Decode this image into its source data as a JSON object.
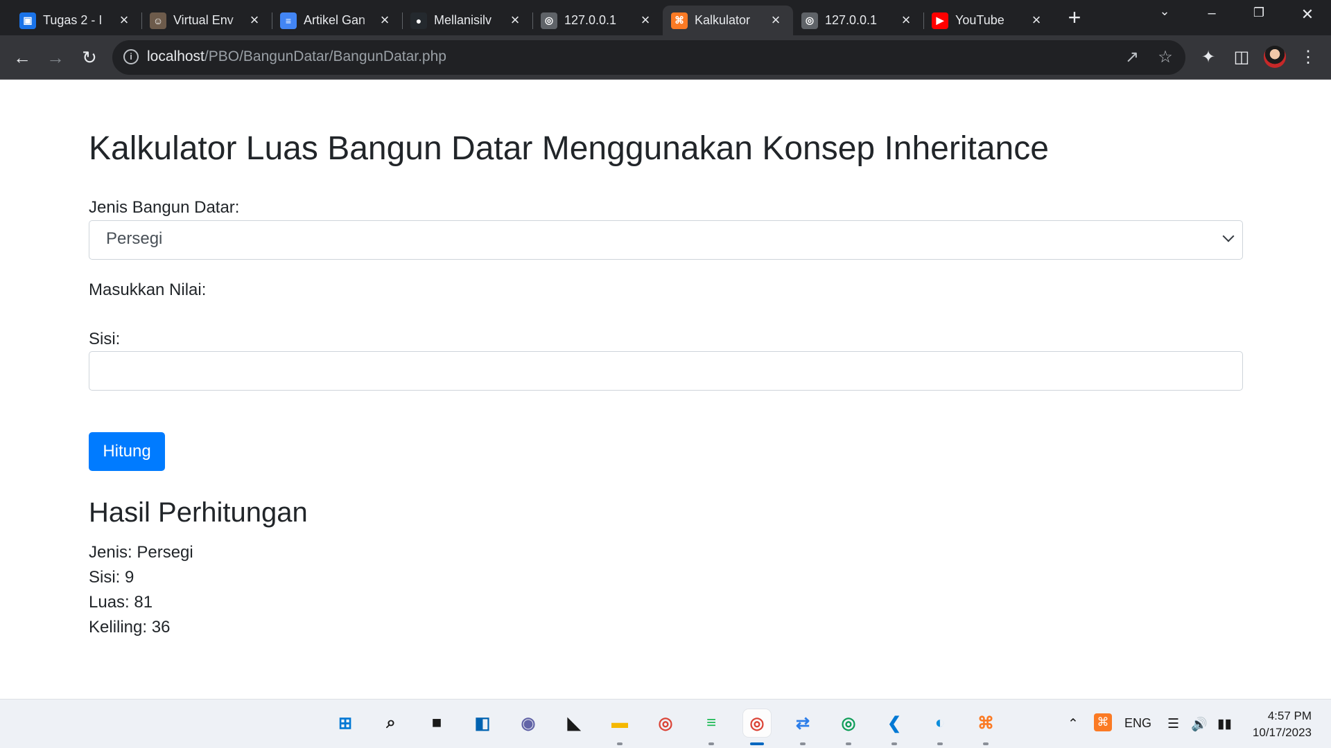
{
  "browser": {
    "tabs": [
      {
        "title": "Tugas 2 - I",
        "favicon": "google-classroom-icon",
        "color": "#1a73e8",
        "glyph": "▣",
        "active": false
      },
      {
        "title": "Virtual Env",
        "favicon": "avatar-icon",
        "color": "#6d5b4b",
        "glyph": "☺",
        "active": false
      },
      {
        "title": "Artikel Gan",
        "favicon": "google-docs-icon",
        "color": "#4285f4",
        "glyph": "≡",
        "active": false
      },
      {
        "title": "Mellanisilv",
        "favicon": "github-icon",
        "color": "#24292e",
        "glyph": "●",
        "active": false
      },
      {
        "title": "127.0.0.1",
        "favicon": "globe-icon",
        "color": "#5f6368",
        "glyph": "◎",
        "active": false
      },
      {
        "title": "Kalkulator",
        "favicon": "xampp-icon",
        "color": "#fb7a24",
        "glyph": "⌘",
        "active": true
      },
      {
        "title": "127.0.0.1",
        "favicon": "globe-icon",
        "color": "#5f6368",
        "glyph": "◎",
        "active": false
      },
      {
        "title": "YouTube",
        "favicon": "youtube-icon",
        "color": "#ff0000",
        "glyph": "▶",
        "active": false
      }
    ],
    "url_host": "localhost",
    "url_path": "/PBO/BangunDatar/BangunDatar.php"
  },
  "page": {
    "title": "Kalkulator Luas Bangun Datar Menggunakan Konsep Inheritance",
    "shape_label": "Jenis Bangun Datar:",
    "shape_selected": "Persegi",
    "values_label": "Masukkan Nilai:",
    "side_label": "Sisi:",
    "side_value": "",
    "submit_label": "Hitung",
    "result_heading": "Hasil Perhitungan",
    "results": [
      "Jenis: Persegi",
      "Sisi: 9",
      "Luas: 81",
      "Keliling: 36"
    ]
  },
  "taskbar": {
    "apps": [
      {
        "name": "windows-start-icon",
        "glyph": "⊞",
        "color": "#0078d4",
        "active": false,
        "open": false
      },
      {
        "name": "search-icon",
        "glyph": "⌕",
        "color": "#1a1a1a",
        "active": false,
        "open": false
      },
      {
        "name": "task-view-icon",
        "glyph": "■",
        "color": "#1a1a1a",
        "active": false,
        "open": false
      },
      {
        "name": "widgets-icon",
        "glyph": "◧",
        "color": "#0063b1",
        "active": false,
        "open": false
      },
      {
        "name": "teams-chat-icon",
        "glyph": "◉",
        "color": "#6264a7",
        "active": false,
        "open": false
      },
      {
        "name": "sticky-notes-icon",
        "glyph": "◣",
        "color": "#1a1a1a",
        "active": false,
        "open": false
      },
      {
        "name": "file-explorer-icon",
        "glyph": "▬",
        "color": "#f5b800",
        "active": false,
        "open": true
      },
      {
        "name": "chrome-icon",
        "glyph": "◎",
        "color": "#db4437",
        "active": false,
        "open": false
      },
      {
        "name": "spotify-icon",
        "glyph": "≡",
        "color": "#1db954",
        "active": false,
        "open": true
      },
      {
        "name": "chrome-profile-icon",
        "glyph": "◎",
        "color": "#db4437",
        "active": true,
        "open": true
      },
      {
        "name": "app-d-icon",
        "glyph": "⇄",
        "color": "#2b7de9",
        "active": false,
        "open": true
      },
      {
        "name": "chrome-profile-p-icon",
        "glyph": "◎",
        "color": "#0f9d58",
        "active": false,
        "open": true
      },
      {
        "name": "vscode-icon",
        "glyph": "❮",
        "color": "#0078d4",
        "active": false,
        "open": true
      },
      {
        "name": "edge-icon",
        "glyph": "◐",
        "color": "#0c8ddb",
        "active": false,
        "open": true
      },
      {
        "name": "xampp-icon",
        "glyph": "⌘",
        "color": "#fb7a24",
        "active": false,
        "open": true
      }
    ],
    "language": "ENG",
    "time": "4:57 PM",
    "date": "10/17/2023"
  }
}
